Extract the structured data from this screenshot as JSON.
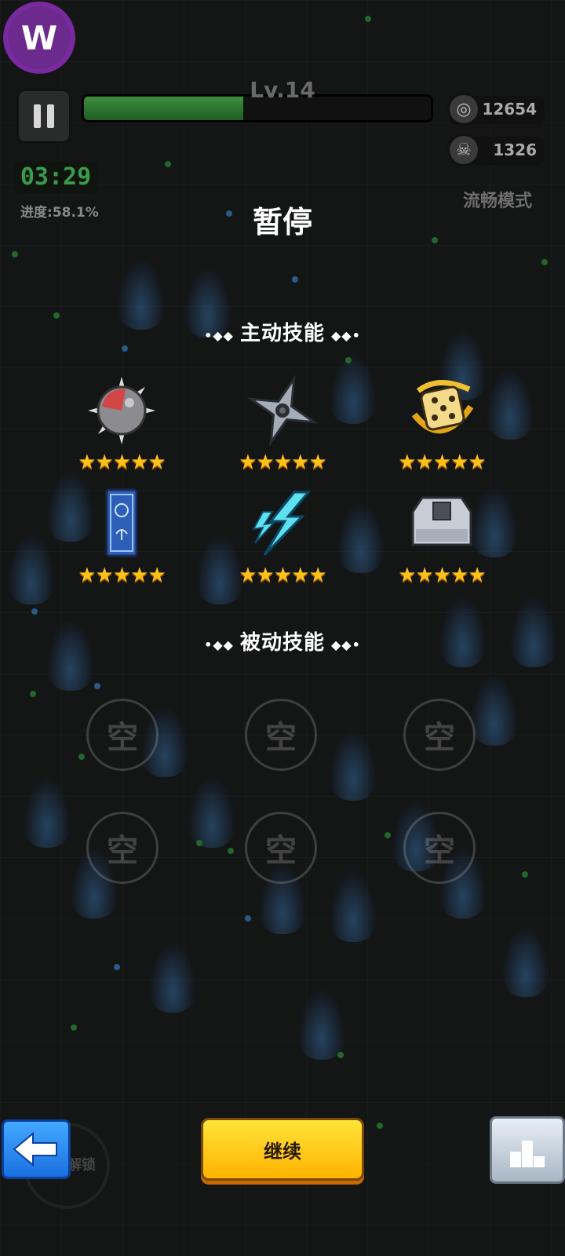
{
  "hud": {
    "logo_letter": "W",
    "level": "Lv.14",
    "xp_fraction": 0.46,
    "coins": "12654",
    "kills": "1326",
    "timer": "03:29",
    "progress": "进度:58.1%",
    "smooth_mode": "流畅模式"
  },
  "pause": {
    "title": "暂停",
    "active_title": "主动技能",
    "passive_title": "被动技能",
    "active_skills": [
      {
        "icon": "spiked-ball-icon",
        "stars": "★★★★★"
      },
      {
        "icon": "shuriken-icon",
        "stars": "★★★★★"
      },
      {
        "icon": "golden-dice-icon",
        "stars": "★★★★★"
      },
      {
        "icon": "talisman-card-icon",
        "stars": "★★★★★"
      },
      {
        "icon": "lightning-icon",
        "stars": "★★★★★"
      },
      {
        "icon": "stone-block-icon",
        "stars": "★★★★★"
      }
    ],
    "empty_label": "空"
  },
  "buttons": {
    "continue": "继续",
    "unlock": "解锁"
  },
  "colors": {
    "xp": "#2f7d31",
    "star": "#ffc21a",
    "continue": "#ffd21e",
    "back": "#2f8cf0"
  }
}
